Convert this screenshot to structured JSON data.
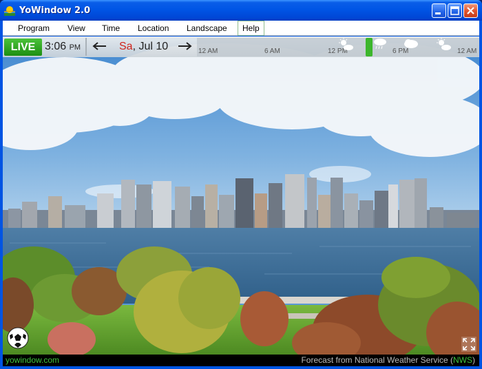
{
  "window": {
    "title": "YoWindow 2.0"
  },
  "menu": {
    "items": [
      {
        "label": "Program"
      },
      {
        "label": "View"
      },
      {
        "label": "Time"
      },
      {
        "label": "Location"
      },
      {
        "label": "Landscape"
      },
      {
        "label": "Help"
      }
    ]
  },
  "topbar": {
    "live_label": "LIVE",
    "time": "3:06",
    "ampm": "PM",
    "date_day": "Sa",
    "date_rest": ", Jul 10",
    "timeline_labels": [
      "12 AM",
      "6 AM",
      "12 PM",
      "6 PM",
      "12 AM"
    ],
    "weather_icons": [
      "sun-cloud-icon",
      "rain-icon",
      "cloud-icon",
      "sun-cloud-icon"
    ]
  },
  "statusbar": {
    "site": "yowindow.com",
    "forecast_prefix": "Forecast from National Weather Service (",
    "forecast_source": "NWS",
    "forecast_suffix": ")"
  },
  "colors": {
    "live_green": "#2aa31e",
    "status_green": "#3ec43e",
    "accent_red": "#d0241c"
  }
}
